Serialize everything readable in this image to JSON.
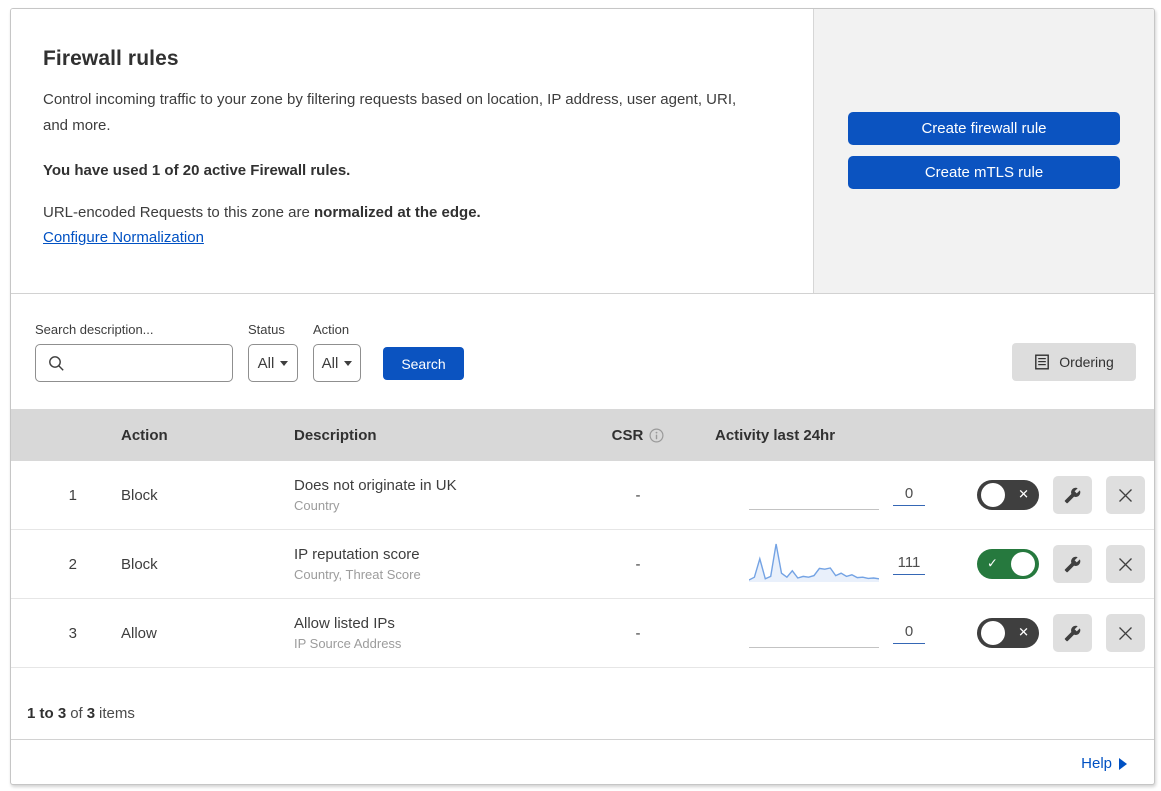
{
  "header": {
    "title": "Firewall rules",
    "description": "Control incoming traffic to your zone by filtering requests based on location, IP address, user agent, URI, and more.",
    "usage_text": "You have used 1 of 20 active Firewall rules.",
    "normalization_prefix": "URL-encoded Requests to this zone are ",
    "normalization_bold": "normalized at the edge.",
    "normalization_link": "Configure Normalization",
    "create_firewall_button": "Create firewall rule",
    "create_mtls_button": "Create mTLS rule"
  },
  "filters": {
    "search_label": "Search description...",
    "search_placeholder": "",
    "status_label": "Status",
    "status_value": "All",
    "action_label": "Action",
    "action_value": "All",
    "search_button": "Search",
    "ordering_button": "Ordering"
  },
  "table": {
    "columns": {
      "action": "Action",
      "description": "Description",
      "csr": "CSR",
      "activity": "Activity last 24hr"
    },
    "rows": [
      {
        "priority": "1",
        "action": "Block",
        "description": "Does not originate in UK",
        "fields": "Country",
        "csr": "-",
        "activity_count": "0",
        "enabled": false,
        "sparkline_values": null
      },
      {
        "priority": "2",
        "action": "Block",
        "description": "IP reputation score",
        "fields": "Country, Threat Score",
        "csr": "-",
        "activity_count": "111",
        "enabled": true,
        "sparkline_values": [
          5,
          12,
          58,
          8,
          14,
          95,
          22,
          12,
          28,
          10,
          14,
          12,
          16,
          34,
          32,
          35,
          16,
          22,
          14,
          18,
          11,
          12,
          9,
          10,
          8
        ]
      },
      {
        "priority": "3",
        "action": "Allow",
        "description": "Allow listed IPs",
        "fields": "IP Source Address",
        "csr": "-",
        "activity_count": "0",
        "enabled": false,
        "sparkline_values": null
      }
    ]
  },
  "footer": {
    "range_bold": "1 to 3",
    "of_text": "of",
    "total_bold": "3",
    "items_text": "items",
    "help_link": "Help"
  },
  "colors": {
    "accent_blue": "#0b53c0",
    "link_blue": "#0051c3",
    "toggle_on_green": "#26793e",
    "toggle_off_dark": "#3f3f3f",
    "sparkline_blue": "#74a3e4",
    "header_gray": "#d8d8d8",
    "panel_gray": "#f2f2f2"
  },
  "icons": {
    "search": "magnifier-icon",
    "ordering": "list-document-icon",
    "csr_info": "info-icon",
    "edit": "wrench-icon",
    "delete": "close-icon"
  }
}
